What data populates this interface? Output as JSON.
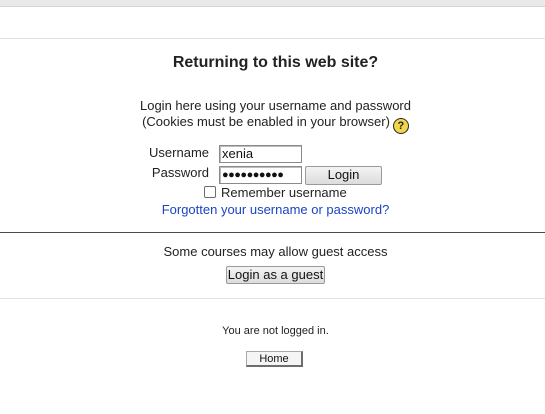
{
  "login": {
    "heading": "Returning to this web site?",
    "intro_line1": "Login here using your username and password",
    "intro_line2": "(Cookies must be enabled in your browser)",
    "help_icon": "help-icon",
    "help_glyph": "?",
    "username_label": "Username",
    "username_value": "xenia",
    "password_label": "Password",
    "password_value": "●●●●●●●●●●",
    "login_button": "Login",
    "remember_label": "Remember username",
    "remember_checked": false,
    "forgot_link": "Forgotten your username or password?"
  },
  "guest": {
    "text": "Some courses may allow guest access",
    "button": "Login as a guest"
  },
  "footer": {
    "logininfo": "You are not logged in.",
    "home_button": "Home"
  },
  "colors": {
    "link": "#1a44c2",
    "help_icon_fill": "#f1d54a"
  }
}
